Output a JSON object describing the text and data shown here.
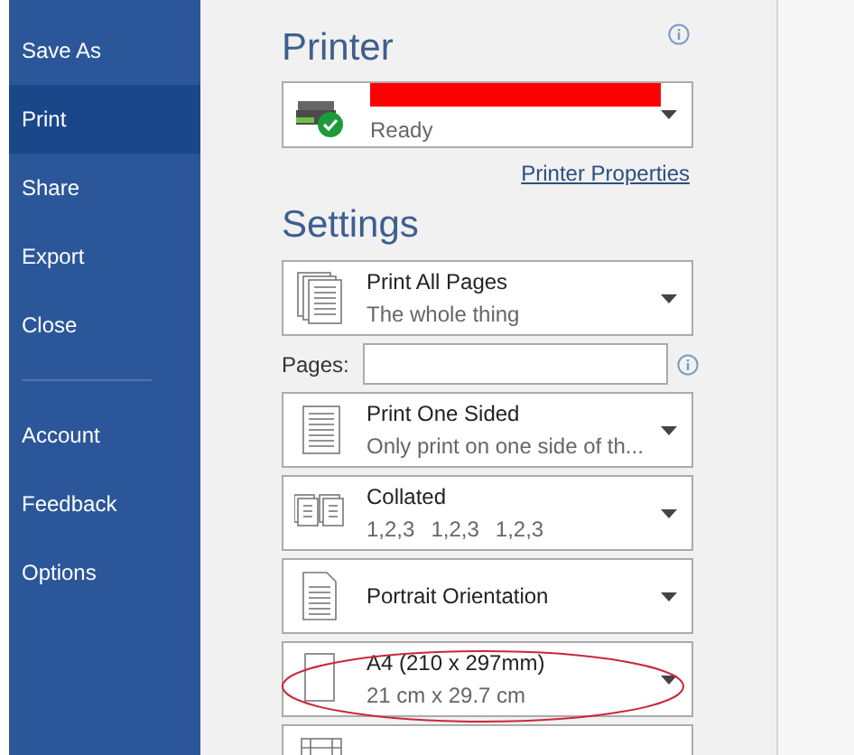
{
  "sidebar": {
    "items": [
      {
        "label": "Save As",
        "selected": false
      },
      {
        "label": "Print",
        "selected": true
      },
      {
        "label": "Share",
        "selected": false
      },
      {
        "label": "Export",
        "selected": false
      },
      {
        "label": "Close",
        "selected": false
      },
      {
        "kind": "divider"
      },
      {
        "label": "Account",
        "selected": false
      },
      {
        "label": "Feedback",
        "selected": false
      },
      {
        "label": "Options",
        "selected": false
      }
    ]
  },
  "printer": {
    "heading": "Printer",
    "status": "Ready",
    "properties_link": "Printer Properties"
  },
  "settings": {
    "heading": "Settings",
    "items": [
      {
        "kind": "dropdown",
        "title": "Print All Pages",
        "subtitle": "The whole thing",
        "circled": false
      },
      {
        "kind": "pages",
        "label": "Pages:"
      },
      {
        "kind": "dropdown",
        "title": "Print One Sided",
        "subtitle": "Only print on one side of th...",
        "circled": false
      },
      {
        "kind": "dropdown",
        "title": "Collated",
        "subtitle_parts": [
          "1,2,3",
          "1,2,3",
          "1,2,3"
        ],
        "circled": false
      },
      {
        "kind": "dropdown",
        "title": "Portrait Orientation",
        "circled": false
      },
      {
        "kind": "dropdown",
        "title": "A4 (210 x 297mm)",
        "subtitle": "21 cm x 29.7 cm",
        "circled": true
      },
      {
        "kind": "dropdown",
        "circled": false
      }
    ]
  }
}
